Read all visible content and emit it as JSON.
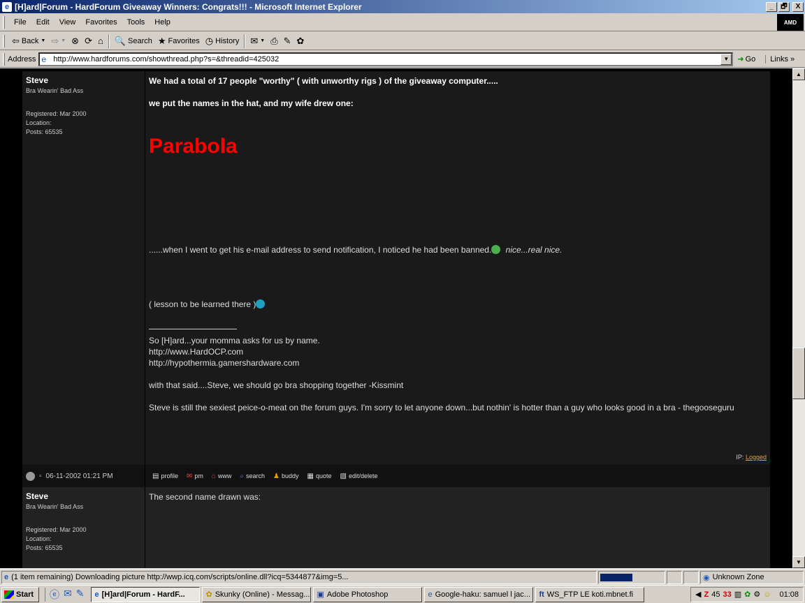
{
  "window": {
    "title": "[H]ard|Forum - HardForum Giveaway Winners: Congrats!!! - Microsoft Internet Explorer",
    "minimize": "_",
    "maximize": "🗗",
    "close": "X"
  },
  "menu": {
    "items": [
      "File",
      "Edit",
      "View",
      "Favorites",
      "Tools",
      "Help"
    ],
    "brand": "AMD"
  },
  "toolbar": {
    "back": "Back",
    "search": "Search",
    "favorites": "Favorites",
    "history": "History"
  },
  "address": {
    "label": "Address",
    "url": "http://www.hardforums.com/showthread.php?s=&threadid=425032",
    "go": "Go",
    "links": "Links"
  },
  "posts": [
    {
      "username": "Steve",
      "usertitle": "Bra Wearin' Bad Ass",
      "registered": "Registered: Mar 2000",
      "location": "Location:",
      "posts": "Posts: 65535",
      "line1": "We had a total of 17 people \"worthy\" ( with unworthy rigs ) of the giveaway computer.....",
      "line2": "we put the names in the hat, and my wife drew one:",
      "winner": "Parabola",
      "line3": "......when I went to get his e-mail address to send notification, I noticed he had been banned.",
      "line3_italic": "nice...real nice.",
      "line4": "( lesson to be learned there )",
      "sig1": "So [H]ard...your momma asks for us by name.",
      "sig2": "http://www.HardOCP.com",
      "sig3": "http://hypothermia.gamershardware.com",
      "sig4": "with that said....Steve, we should go bra shopping together -Kissmint",
      "sig5": "Steve is still the sexiest peice-o-meat on the forum guys. I'm sorry to let anyone down...but nothin' is hotter than a guy who looks good in a bra - thegooseguru",
      "ip_label": "IP:",
      "ip_link": "Logged",
      "date": "06-11-2002 01:21 PM",
      "actions": {
        "profile": "profile",
        "pm": "pm",
        "www": "www",
        "search": "search",
        "buddy": "buddy",
        "quote": "quote",
        "edit": "edit/delete"
      }
    },
    {
      "username": "Steve",
      "usertitle": "Bra Wearin' Bad Ass",
      "registered": "Registered: Mar 2000",
      "location": "Location:",
      "posts": "Posts: 65535",
      "line1": "The second name drawn was:"
    }
  ],
  "status": {
    "text": "(1 item remaining) Downloading picture http://wwp.icq.com/scripts/online.dll?icq=5344877&img=5...",
    "progress": 0.5,
    "zone": "Unknown Zone"
  },
  "taskbar": {
    "start": "Start",
    "tasks": [
      "[H]ard|Forum - HardF...",
      "Skunky (Online) - Messag...",
      "Adobe Photoshop",
      "Google-haku: samuel l jac...",
      "WS_FTP LE koti.mbnet.fi"
    ],
    "tray_num1": "45",
    "tray_num2": "33",
    "clock": "01:08"
  },
  "colors": {
    "titlebar": "#0a246a",
    "winner_text": "#ff0000",
    "post_bg": "#1a1a1a",
    "link": "#e0a040"
  }
}
